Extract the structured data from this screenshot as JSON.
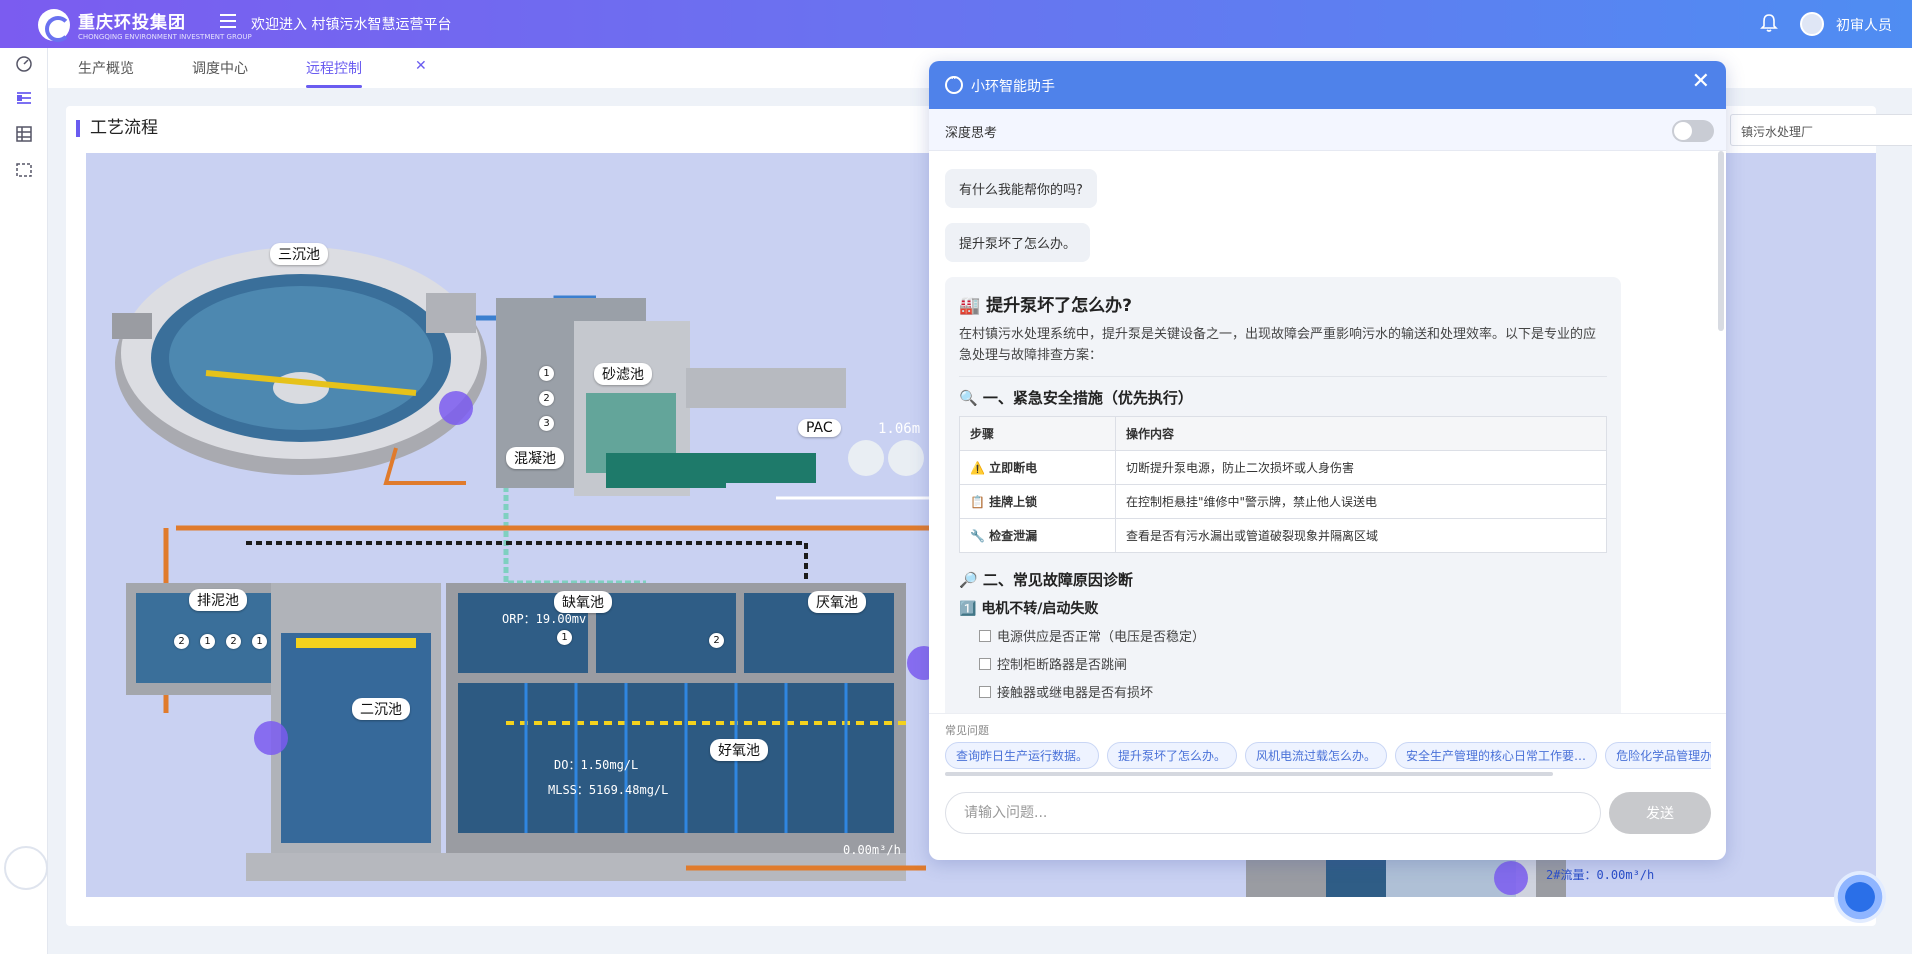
{
  "header": {
    "logo_text": "重庆环投集团",
    "logo_sub": "CHONGQING ENVIRONMENT INVESTMENT GROUP",
    "welcome": "欢迎进入 村镇污水智慧运营平台",
    "user_name": "初审人员"
  },
  "tabs": [
    {
      "label": "生产概览"
    },
    {
      "label": "调度中心"
    },
    {
      "label": "远程控制"
    }
  ],
  "card": {
    "title": "工艺流程",
    "plant_select": "镇污水处理厂"
  },
  "process": {
    "labels": {
      "sedimentation3": "三沉池",
      "sand_filter": "砂滤池",
      "coagulation": "混凝池",
      "sludge": "排泥池",
      "anoxic": "缺氧池",
      "anaerobic": "厌氧池",
      "secondary": "二沉池",
      "aerobic": "好氧池",
      "pac": "PAC"
    },
    "numbers": [
      "1",
      "2",
      "3"
    ],
    "sludge_numbers": [
      "2",
      "1",
      "2",
      "1"
    ],
    "pac_value": "1.06m",
    "orp": "ORP：19.00mv",
    "do": "DO：1.50mg/L",
    "mlss": "MLSS：5169.48mg/L",
    "flow1": "0.00m³/h",
    "flow2": "2#流量：0.00m³/h"
  },
  "chat": {
    "title": "小环智能助手",
    "deep_think": "深度思考",
    "greeting": "有什么我能帮你的吗?",
    "user_question": "提升泵坏了怎么办。",
    "answer": {
      "heading": "提升泵坏了怎么办?",
      "intro": "在村镇污水处理系统中，提升泵是关键设备之一，出现故障会严重影响污水的输送和处理效率。以下是专业的应急处理与故障排查方案：",
      "section1": "一、紧急安全措施（优先执行）",
      "table_headers": [
        "步骤",
        "操作内容"
      ],
      "rows": [
        {
          "icon": "⚠️",
          "step": "立即断电",
          "content": "切断提升泵电源，防止二次损坏或人身伤害"
        },
        {
          "icon": "📋",
          "step": "挂牌上锁",
          "content": "在控制柜悬挂\"维修中\"警示牌，禁止他人误送电"
        },
        {
          "icon": "🔧",
          "step": "检查泄漏",
          "content": "查看是否有污水漏出或管道破裂现象并隔离区域"
        }
      ],
      "section2": "二、常见故障原因诊断",
      "sub1": "电机不转/启动失败",
      "checks": [
        "电源供应是否正常（电压是否稳定）",
        "控制柜断路器是否跳闸",
        "接触器或继电器是否有损坏"
      ]
    },
    "faq_label": "常见问题",
    "faq": [
      "查询昨日生产运行数据。",
      "提升泵坏了怎么办。",
      "风机电流过载怎么办。",
      "安全生产管理的核心日常工作要…",
      "危险化学品管理办法"
    ],
    "input_placeholder": "请输入问题...",
    "send_label": "发送"
  },
  "colors": {
    "header_start": "#7b5cf0",
    "header_end": "#4f8df2",
    "accent": "#6a5cf0",
    "chat_header": "#4f82ea"
  }
}
